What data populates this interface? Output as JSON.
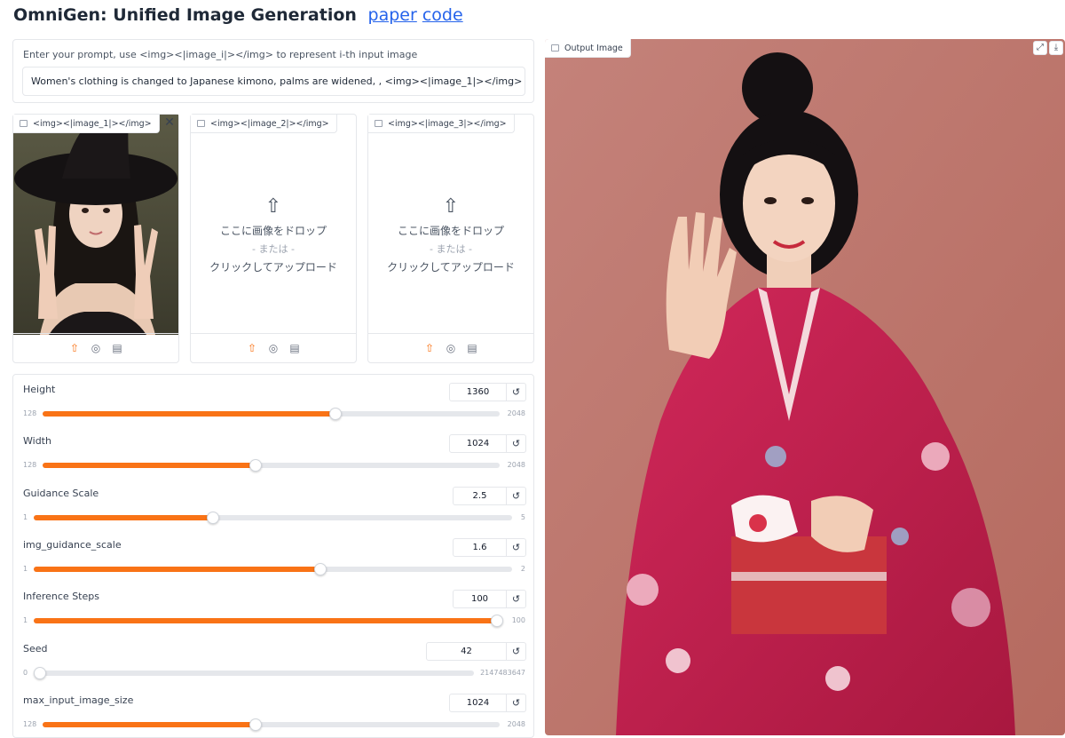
{
  "header": {
    "title": "OmniGen: Unified Image Generation",
    "link_paper": "paper",
    "link_code": "code"
  },
  "prompt": {
    "label": "Enter your prompt, use <img><|image_i|></img> to represent i-th input image",
    "value": "Women's clothing is changed to Japanese kimono, palms are widened, ,  <img><|image_1|></img>"
  },
  "inputs": [
    {
      "label": "<img><|image_1|></img>",
      "has_image": true,
      "image_desc": "Woman in black witch hat making peace signs"
    },
    {
      "label": "<img><|image_2|></img>",
      "has_image": false
    },
    {
      "label": "<img><|image_3|></img>",
      "has_image": false
    }
  ],
  "dropzone": {
    "line1": "ここに画像をドロップ",
    "line2": "- または -",
    "line3": "クリックしてアップロード"
  },
  "sliders": [
    {
      "label": "Height",
      "value": "1360",
      "min": "128",
      "max": "2048",
      "frac": 0.6417
    },
    {
      "label": "Width",
      "value": "1024",
      "min": "128",
      "max": "2048",
      "frac": 0.4667
    },
    {
      "label": "Guidance Scale",
      "value": "2.5",
      "min": "1",
      "max": "5",
      "frac": 0.375
    },
    {
      "label": "img_guidance_scale",
      "value": "1.6",
      "min": "1",
      "max": "2",
      "frac": 0.6
    },
    {
      "label": "Inference Steps",
      "value": "100",
      "min": "1",
      "max": "100",
      "frac": 1.0
    },
    {
      "label": "Seed",
      "value": "42",
      "min": "0",
      "max": "2147483647",
      "frac": 0.0
    },
    {
      "label": "max_input_image_size",
      "value": "1024",
      "min": "128",
      "max": "2048",
      "frac": 0.4667
    }
  ],
  "output": {
    "label": "Output Image",
    "image_desc": "Smiling woman in red floral Japanese kimono raising open palm"
  },
  "colors": {
    "accent": "#f97316",
    "link": "#2563eb",
    "output_bg": "#c47a6f",
    "kimono": "#c2224f"
  },
  "icons": [
    "image-icon",
    "close-icon",
    "upload-icon",
    "webcam-icon",
    "clipboard-icon",
    "reset-icon",
    "fullscreen-icon",
    "download-icon"
  ]
}
